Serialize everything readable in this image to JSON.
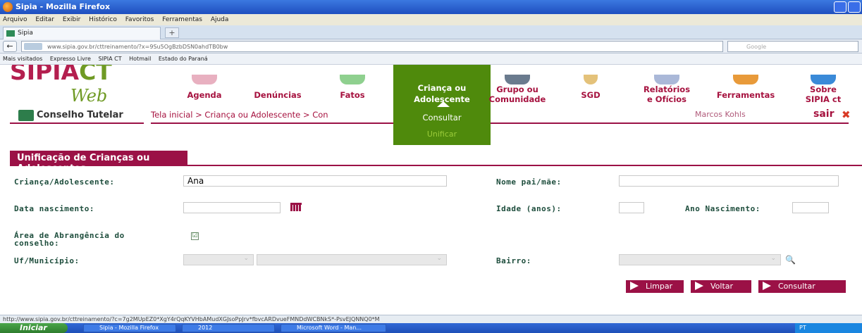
{
  "window": {
    "title": "Sipia - Mozilla Firefox"
  },
  "menubar": [
    "Arquivo",
    "Editar",
    "Exibir",
    "Histórico",
    "Favoritos",
    "Ferramentas",
    "Ajuda"
  ],
  "tab": {
    "title": "Sipia",
    "newtab": "+"
  },
  "navbar": {
    "url": "www.sipia.gov.br/cttreinamento/?x=9Su5OgBzbDSN0ahdTB0bw",
    "search_placeholder": "Google"
  },
  "bookmarks": [
    "Mais visitados",
    "Expresso Livre",
    "SIPIA CT",
    "Hotmail",
    "Estado do Paraná"
  ],
  "logo": {
    "main": "SIPIA",
    "suffix": "CT",
    "sub": "Web"
  },
  "nav": [
    {
      "line1": "Agenda",
      "line2": ""
    },
    {
      "line1": "Denúncias",
      "line2": ""
    },
    {
      "line1": "Fatos",
      "line2": ""
    },
    {
      "line1": "Criança ou",
      "line2": "Adolescente"
    },
    {
      "line1": "Grupo ou",
      "line2": "Comunidade"
    },
    {
      "line1": "SGD",
      "line2": ""
    },
    {
      "line1": "Relatórios",
      "line2": "e Ofícios"
    },
    {
      "line1": "Ferramentas",
      "line2": ""
    },
    {
      "line1": "Sobre",
      "line2": "SIPIA ct"
    }
  ],
  "header": {
    "conselho": "Conselho Tutelar",
    "breadcrumb": "Tela inicial > Criança ou Adolescente > Con",
    "user": "Marcos Kohls",
    "logout": "sair"
  },
  "dropdown": {
    "item1": "Consultar",
    "item2": "Unificar"
  },
  "section_title": "Unificação de Crianças ou Adolescentes",
  "form": {
    "crianca_label": "Criança/Adolescente:",
    "crianca_value": "Ana",
    "nome_pai_label": "Nome pai/mãe:",
    "nome_pai_value": "",
    "data_nasc_label": "Data nascimento:",
    "data_nasc_value": "",
    "idade_label": "Idade (anos):",
    "idade_value": "",
    "ano_nasc_label": "Ano Nascimento:",
    "ano_nasc_value": "",
    "area_label_1": "Área de Abrangência do",
    "area_label_2": "conselho:",
    "area_checked": "☑",
    "uf_label": "Uf/Município:",
    "bairro_label": "Bairro:"
  },
  "buttons": {
    "limpar": "Limpar",
    "voltar": "Voltar",
    "consultar": "Consultar"
  },
  "status_text": "http://www.sipia.gov.br/cttreinamento/?c=7g2MUpEZ0*XgY4rQqKYVHbAMudXGJsoPpJrv*fbvcARDvueFMNDdWCBNkS*-PsvEJQNNQ0*M",
  "taskbar": {
    "start": "Iniciar",
    "items": [
      "Sipia - Mozilla Firefox",
      "2012",
      "Microsoft Word - Man..."
    ],
    "tray": "PT"
  }
}
